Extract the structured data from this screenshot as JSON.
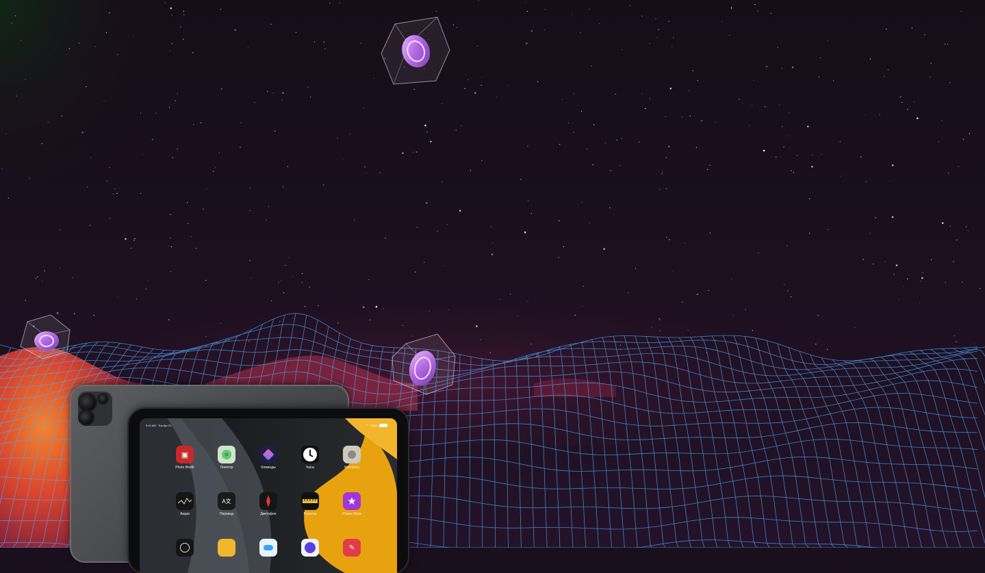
{
  "device": {
    "status_bar": {
      "time": "9:41 AM",
      "date": "Tue Apr 21",
      "battery_text": "100%"
    },
    "apps_row1": [
      {
        "label": "Photo Booth",
        "icon": "photo-booth-icon"
      },
      {
        "label": "Локатор",
        "icon": "locator-icon"
      },
      {
        "label": "Команды",
        "icon": "shortcuts-icon"
      },
      {
        "label": "Часы",
        "icon": "clock-icon"
      },
      {
        "label": "Контакты",
        "icon": "contacts-icon"
      }
    ],
    "apps_row2": [
      {
        "label": "Акции",
        "icon": "stocks-icon"
      },
      {
        "label": "Перевод",
        "icon": "translate-icon"
      },
      {
        "label": "Диктофон",
        "icon": "voice-memos-icon"
      },
      {
        "label": "Рулетка",
        "icon": "measure-icon"
      },
      {
        "label": "iTunes Store",
        "icon": "itunes-store-icon"
      }
    ],
    "apps_row3_icons": [
      "clock-partial-icon",
      "tips-icon",
      "weather-icon",
      "podcast-icon",
      "app-store-red-icon"
    ]
  },
  "colors": {
    "sky": "#1a0f1d",
    "grid_blue": "#4aa8ff",
    "terrain_orange": "#e8652a",
    "coin_purple": "#b067e0"
  }
}
